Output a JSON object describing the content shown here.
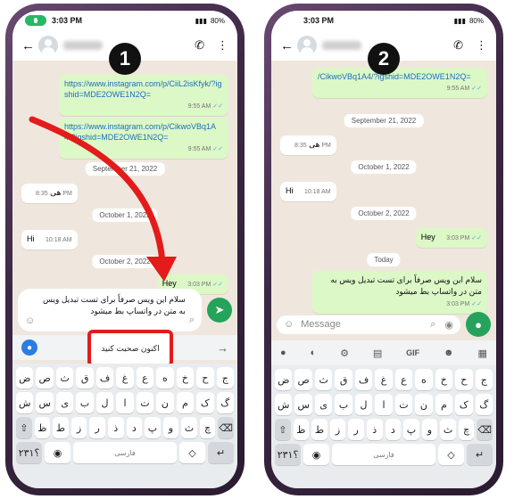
{
  "phone1": {
    "step_number": "1",
    "status": {
      "time": "3:03 PM",
      "battery": "80%"
    },
    "messages": {
      "link1": {
        "text": "https://www.instagram.com/p/CiiL2isKfyk/?igshid=MDE2OWE1N2Q=",
        "time": "9:55 AM"
      },
      "link2": {
        "text": "https://www.instagram.com/p/CikwoVBq1A4/?igshid=MDE2OWE1N2Q=",
        "time": "9:55 AM"
      },
      "date1": "September 21, 2022",
      "he": {
        "text": "هی",
        "time": "8:35 PM"
      },
      "date2": "October 1, 2022",
      "hi": {
        "text": "Hi",
        "time": "10:18 AM"
      },
      "date3": "October 2, 2022",
      "hey": {
        "text": "Hey",
        "time": "3:03 PM"
      }
    },
    "draft_text": "سلام این ویس صرفاً برای تست تبدیل ویس به متن در واتساپ بط میشود",
    "speak_now": "اکنون صحبت کنید",
    "keyboard": {
      "row1": [
        "ض",
        "ص",
        "ث",
        "ق",
        "ف",
        "غ",
        "ع",
        "ه",
        "خ",
        "ح",
        "ج"
      ],
      "row2": [
        "ش",
        "س",
        "ی",
        "ب",
        "ل",
        "ا",
        "ت",
        "ن",
        "م",
        "ک",
        "گ"
      ],
      "row3": [
        "ظ",
        "ط",
        "ز",
        "ر",
        "ذ",
        "د",
        "پ",
        "و",
        "ث",
        "چ"
      ],
      "num_key": "۲۳۱؟",
      "space_label": "فارسی"
    }
  },
  "phone2": {
    "step_number": "2",
    "status": {
      "time": "3:03 PM",
      "battery": "80%"
    },
    "messages": {
      "link": {
        "text": "/CikwoVBq1A4/?igshid=MDE2OWE1N2Q=",
        "time": "9:55 AM"
      },
      "date1": "September 21, 2022",
      "he": {
        "text": "هی",
        "time": "8:35 PM"
      },
      "date2": "October 1, 2022",
      "hi": {
        "text": "Hi",
        "time": "10:18 AM"
      },
      "date3": "October 2, 2022",
      "hey": {
        "text": "Hey",
        "time": "3:03 PM"
      },
      "date4": "Today",
      "voice": {
        "text": "سلام این ویس صرفاً برای تست تبدیل ویس به متن در واتساپ بط میشود",
        "time": "3:03 PM"
      }
    },
    "input_placeholder": "Message",
    "toolbar_gif": "GIF",
    "keyboard": {
      "row1": [
        "ض",
        "ص",
        "ث",
        "ق",
        "ف",
        "غ",
        "ع",
        "ه",
        "خ",
        "ح",
        "ج"
      ],
      "row2": [
        "ش",
        "س",
        "ی",
        "ب",
        "ل",
        "ا",
        "ت",
        "ن",
        "م",
        "ک",
        "گ"
      ],
      "row3": [
        "ظ",
        "ط",
        "ز",
        "ر",
        "ذ",
        "د",
        "پ",
        "و",
        "ث",
        "چ"
      ],
      "num_key": "۲۳۱؟",
      "space_label": "فارسی"
    }
  },
  "colors": {
    "annotation_red": "#e31b1b",
    "whatsapp_green": "#25a35a",
    "out_bubble": "#dcf8c6"
  }
}
